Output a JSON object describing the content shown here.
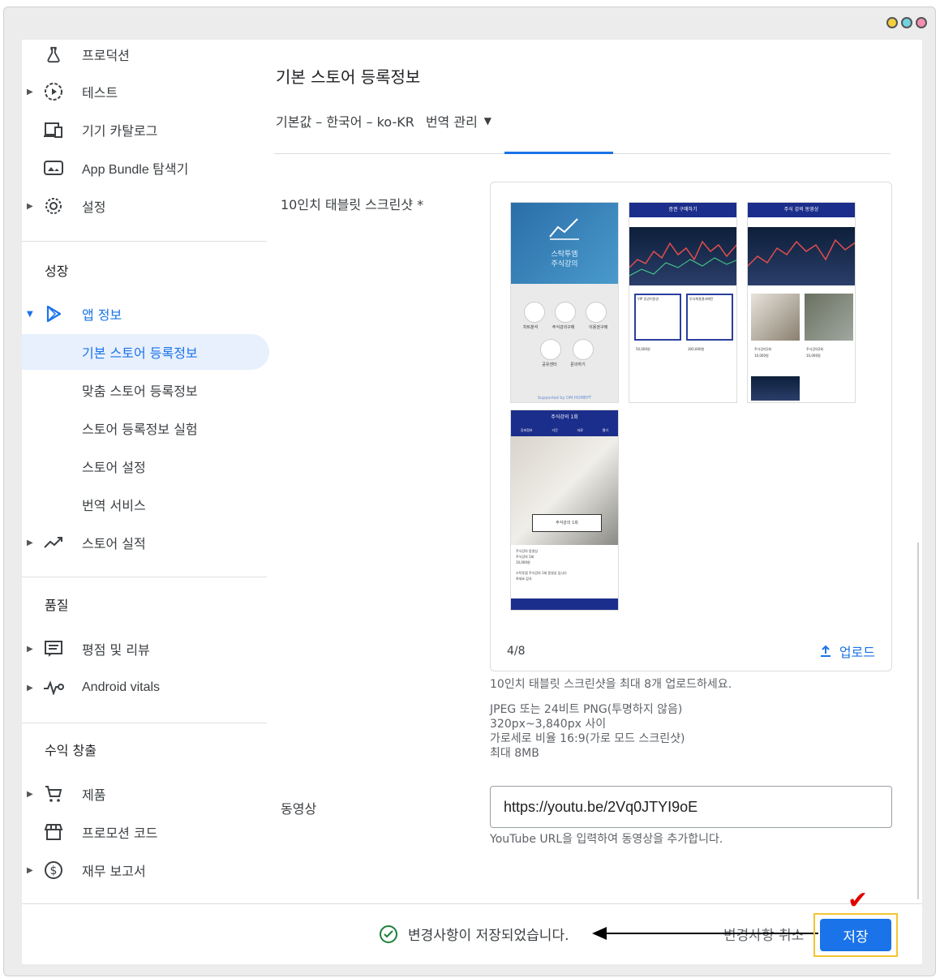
{
  "window": {
    "controls": [
      "yellow-dot",
      "cyan-dot",
      "pink-dot"
    ],
    "control_colors": [
      "#f4d03f",
      "#6fd3e0",
      "#f48fb1"
    ]
  },
  "sidebar": {
    "top_items": [
      {
        "label": "프로덕션",
        "icon": "flask-icon",
        "caret": false
      },
      {
        "label": "테스트",
        "icon": "play-circle-icon",
        "caret": true
      },
      {
        "label": "기기 카탈로그",
        "icon": "devices-icon",
        "caret": false
      },
      {
        "label": "App Bundle 탐색기",
        "icon": "bundle-icon",
        "caret": false
      },
      {
        "label": "설정",
        "icon": "gear-icon",
        "caret": true
      }
    ],
    "growth_title": "성장",
    "growth_items": [
      {
        "label": "앱 정보",
        "icon": "play-store-icon",
        "caret": true
      },
      {
        "label": "기본 스토어 등록정보",
        "active": true
      },
      {
        "label": "맞춤 스토어 등록정보"
      },
      {
        "label": "스토어 등록정보 실험"
      },
      {
        "label": "스토어 설정"
      },
      {
        "label": "번역 서비스"
      },
      {
        "label": "스토어 실적",
        "icon": "trending-icon",
        "caret": true
      }
    ],
    "quality_title": "품질",
    "quality_items": [
      {
        "label": "평점 및 리뷰",
        "icon": "review-icon",
        "caret": true
      },
      {
        "label": "Android vitals",
        "icon": "vitals-icon",
        "caret": true
      }
    ],
    "monetize_title": "수익 창출",
    "monetize_items": [
      {
        "label": "제품",
        "icon": "cart-icon",
        "caret": true
      },
      {
        "label": "프로모션 코드",
        "icon": "store-icon",
        "caret": false
      },
      {
        "label": "재무 보고서",
        "icon": "dollar-icon",
        "caret": true
      }
    ]
  },
  "main": {
    "title": "기본 스토어 등록정보",
    "lang_default": "기본값 – 한국어 – ko-KR",
    "lang_manage": "번역 관리",
    "tablet_label": "10인치 태블릿 스크린샷 *",
    "shots": [
      {
        "title": "",
        "caption_a": "스탁투엠",
        "caption_b": "주식강의",
        "icons_row1": [
          "차트분석",
          "주식강의구매",
          "이용권구매"
        ],
        "icons_row2": [
          "공유센터",
          "문의하기"
        ],
        "footer": "Supported by DM HOMEPT"
      },
      {
        "title": "증권 구매하기",
        "cards": [
          "VIP 증권이용권",
          "투자체결결과패턴"
        ],
        "prices": [
          "50,000원",
          "300,000원"
        ]
      },
      {
        "title": "주식 강의 동영상",
        "cards": [
          "주식강의1회",
          "주식강의2회"
        ],
        "prices": [
          "10,000원",
          "10,000원"
        ]
      },
      {
        "title": "주식강의 1회",
        "tabs": [
          "강좌정보",
          "기간",
          "자료",
          "평가"
        ],
        "banner": "주식강의 1회",
        "lines": [
          "주식강의 동영상",
          "주식강의 1회",
          "10,000원",
          "스탁투엠 주식강의 1회 동영상 입니다",
          "하세요 감사"
        ]
      }
    ],
    "count": "4/8",
    "upload": "업로드",
    "help_main": "10인치 태블릿 스크린샷을 최대 8개 업로드하세요.",
    "help_specs": [
      "JPEG 또는 24비트 PNG(투명하지 않음)",
      "320px~3,840px 사이",
      "가로세로 비율 16:9(가로 모드 스크린샷)",
      "최대 8MB"
    ],
    "video_label": "동영상",
    "video_value": "https://youtu.be/2Vq0JTYI9oE",
    "video_help": "YouTube URL을 입력하여 동영상을 추가합니다."
  },
  "footer": {
    "saved_message": "변경사항이 저장되었습니다.",
    "cancel": "변경사항 취소",
    "save": "저장"
  },
  "colors": {
    "accent": "#1a73e8",
    "active_bg": "#e8f0fe",
    "highlight": "#f4c431",
    "check": "#e00000",
    "navy": "#1c2e8c"
  }
}
